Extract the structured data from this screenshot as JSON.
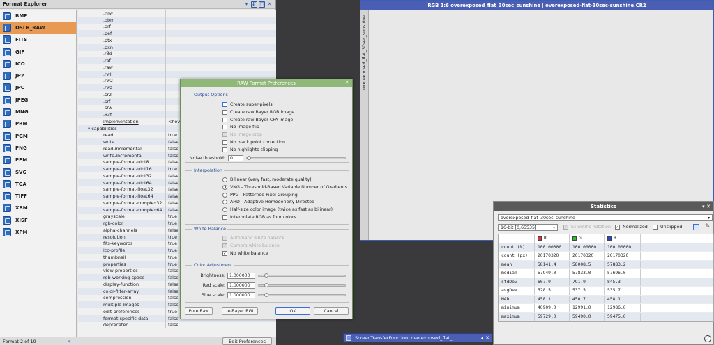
{
  "format_explorer": {
    "title": "Format Explorer",
    "formats": [
      "BMP",
      "DSLR_RAW",
      "FITS",
      "GIF",
      "ICO",
      "JP2",
      "JPC",
      "JPEG",
      "MNG",
      "PBM",
      "PGM",
      "PNG",
      "PPM",
      "SVG",
      "TGA",
      "TIFF",
      "XBM",
      "XISF",
      "XPM"
    ],
    "selected": "DSLR_RAW",
    "tree": [
      {
        "k": ".nrw",
        "v": "",
        "d": 2
      },
      {
        "k": ".obm",
        "v": "",
        "d": 2
      },
      {
        "k": ".orf",
        "v": "",
        "d": 2
      },
      {
        "k": ".pef",
        "v": "",
        "d": 2
      },
      {
        "k": ".ptx",
        "v": "",
        "d": 2
      },
      {
        "k": ".pxn",
        "v": "",
        "d": 2
      },
      {
        "k": ".r3d",
        "v": "",
        "d": 2
      },
      {
        "k": ".raf",
        "v": "",
        "d": 2
      },
      {
        "k": ".raw",
        "v": "",
        "d": 2
      },
      {
        "k": ".rwl",
        "v": "",
        "d": 2
      },
      {
        "k": ".rw2",
        "v": "",
        "d": 2
      },
      {
        "k": ".rwz",
        "v": "",
        "d": 2
      },
      {
        "k": ".sr2",
        "v": "",
        "d": 2
      },
      {
        "k": ".srf",
        "v": "",
        "d": 2
      },
      {
        "k": ".srw",
        "v": "",
        "d": 2
      },
      {
        "k": ".x3f",
        "v": "",
        "d": 2
      },
      {
        "k": "implementation",
        "v": "<hov",
        "d": 1
      },
      {
        "k": "capabilities",
        "v": "",
        "d": 0
      },
      {
        "k": "read",
        "v": "true",
        "d": 1
      },
      {
        "k": "write",
        "v": "false",
        "d": 1
      },
      {
        "k": "read-incremental",
        "v": "false",
        "d": 1
      },
      {
        "k": "write-incremental",
        "v": "false",
        "d": 1
      },
      {
        "k": "sample-format-uint8",
        "v": "false",
        "d": 1
      },
      {
        "k": "sample-format-uint16",
        "v": "true",
        "d": 1
      },
      {
        "k": "sample-format-uint32",
        "v": "false",
        "d": 1
      },
      {
        "k": "sample-format-uint64",
        "v": "false",
        "d": 1
      },
      {
        "k": "sample-format-float32",
        "v": "false",
        "d": 1
      },
      {
        "k": "sample-format-float64",
        "v": "false",
        "d": 1
      },
      {
        "k": "sample-format-complex32",
        "v": "false",
        "d": 1
      },
      {
        "k": "sample-format-complex64",
        "v": "false",
        "d": 1
      },
      {
        "k": "grayscale",
        "v": "true",
        "d": 1
      },
      {
        "k": "rgb-color",
        "v": "true",
        "d": 1
      },
      {
        "k": "alpha-channels",
        "v": "false",
        "d": 1
      },
      {
        "k": "resolution",
        "v": "true",
        "d": 1
      },
      {
        "k": "fits-keywords",
        "v": "true",
        "d": 1
      },
      {
        "k": "icc-profile",
        "v": "true",
        "d": 1
      },
      {
        "k": "thumbnail",
        "v": "true",
        "d": 1
      },
      {
        "k": "properties",
        "v": "true",
        "d": 1
      },
      {
        "k": "view-properties",
        "v": "false",
        "d": 1
      },
      {
        "k": "rgb-working-space",
        "v": "false",
        "d": 1
      },
      {
        "k": "display-function",
        "v": "false",
        "d": 1
      },
      {
        "k": "color-filter-array",
        "v": "false",
        "d": 1
      },
      {
        "k": "compression",
        "v": "false",
        "d": 1
      },
      {
        "k": "multiple-images",
        "v": "false",
        "d": 1
      },
      {
        "k": "edit-preferences",
        "v": "true",
        "d": 1
      },
      {
        "k": "format-specific-data",
        "v": "false",
        "d": 1
      },
      {
        "k": "deprecated",
        "v": "false",
        "d": 1
      }
    ],
    "status": "Format 2 of 19",
    "edit_button": "Edit Preferences"
  },
  "image_window": {
    "title": "RGB 1:6 overexposed_flat_30sec_sunshine | overexposed-flat-30sec-sunshine.CR2",
    "side_label": "overexposed_flat_30sec_sunshine"
  },
  "dialog": {
    "title": "RAW Format Preferences",
    "output_group": "Output Options",
    "output_options": [
      {
        "label": "Create super-pixels",
        "checked": false,
        "disabled": false
      },
      {
        "label": "Create raw Bayer RGB image",
        "checked": false,
        "disabled": false
      },
      {
        "label": "Create raw Bayer CFA image",
        "checked": false,
        "disabled": false
      },
      {
        "label": "No image flip",
        "checked": false,
        "disabled": false
      },
      {
        "label": "No image crop",
        "checked": false,
        "disabled": true
      },
      {
        "label": "No black point correction",
        "checked": false,
        "disabled": false
      },
      {
        "label": "No highlights clipping",
        "checked": false,
        "disabled": false
      }
    ],
    "noise_label": "Noise threshold:",
    "noise_value": "0",
    "interp_group": "Interpolation",
    "interp_options": [
      {
        "label": "Bilinear (very fast, moderate quality)",
        "checked": false
      },
      {
        "label": "VNG - Threshold-Based Variable Number of Gradients",
        "checked": true
      },
      {
        "label": "PPG - Patterned Pixel Grouping",
        "checked": false
      },
      {
        "label": "AHD - Adaptive Homogeneity-Directed",
        "checked": false
      },
      {
        "label": "Half-size color image (twice as fast as bilinear)",
        "checked": false
      }
    ],
    "interp_rgb": "Interpolate RGB as four colors",
    "wb_group": "White Balance",
    "wb_options": [
      {
        "label": "Automatic white balance",
        "checked": false,
        "disabled": true
      },
      {
        "label": "Camera white balance",
        "checked": true,
        "disabled": true
      },
      {
        "label": "No white balance",
        "checked": true,
        "disabled": false
      }
    ],
    "color_group": "Color Adjustment",
    "brightness_label": "Brightness:",
    "brightness_value": "1.000000",
    "red_label": "Red scale:",
    "red_value": "1.000000",
    "blue_label": "Blue scale:",
    "blue_value": "1.000000",
    "btn_pure_raw": "Pure Raw",
    "btn_debayer": "le-Bayer RGI",
    "btn_ok": "OK",
    "btn_cancel": "Cancel"
  },
  "statistics": {
    "title": "Statistics",
    "view": "overexposed_flat_30sec_sunshine",
    "range": "16-bit [0,65535]",
    "scientific": "Scientific notation",
    "normalized": "Normalized",
    "unclipped": "Unclipped",
    "channels": [
      {
        "name": "R",
        "color": "#e53030"
      },
      {
        "name": "G",
        "color": "#2fc02f"
      },
      {
        "name": "B",
        "color": "#2a45d6"
      }
    ],
    "rows": [
      [
        "count (%)",
        "100.00000",
        "100.00000",
        "100.00000"
      ],
      [
        "count (px)",
        "20170320",
        "20170320",
        "20170320"
      ],
      [
        "mean",
        "58141.4",
        "58008.5",
        "57883.2"
      ],
      [
        "median",
        "57949.0",
        "57833.0",
        "57696.0"
      ],
      [
        "stdDev",
        "607.9",
        "791.9",
        "845.3"
      ],
      [
        "avgDev",
        "528.5",
        "537.5",
        "535.7"
      ],
      [
        "MAD",
        "458.1",
        "450.7",
        "458.1"
      ],
      [
        "minimum",
        "40909.0",
        "12991.0",
        "12986.0"
      ],
      [
        "maximum",
        "59729.0",
        "59490.0",
        "59475.0"
      ]
    ]
  },
  "stf": {
    "title": "ScreenTransferFunction: overexposed_flat_..."
  }
}
